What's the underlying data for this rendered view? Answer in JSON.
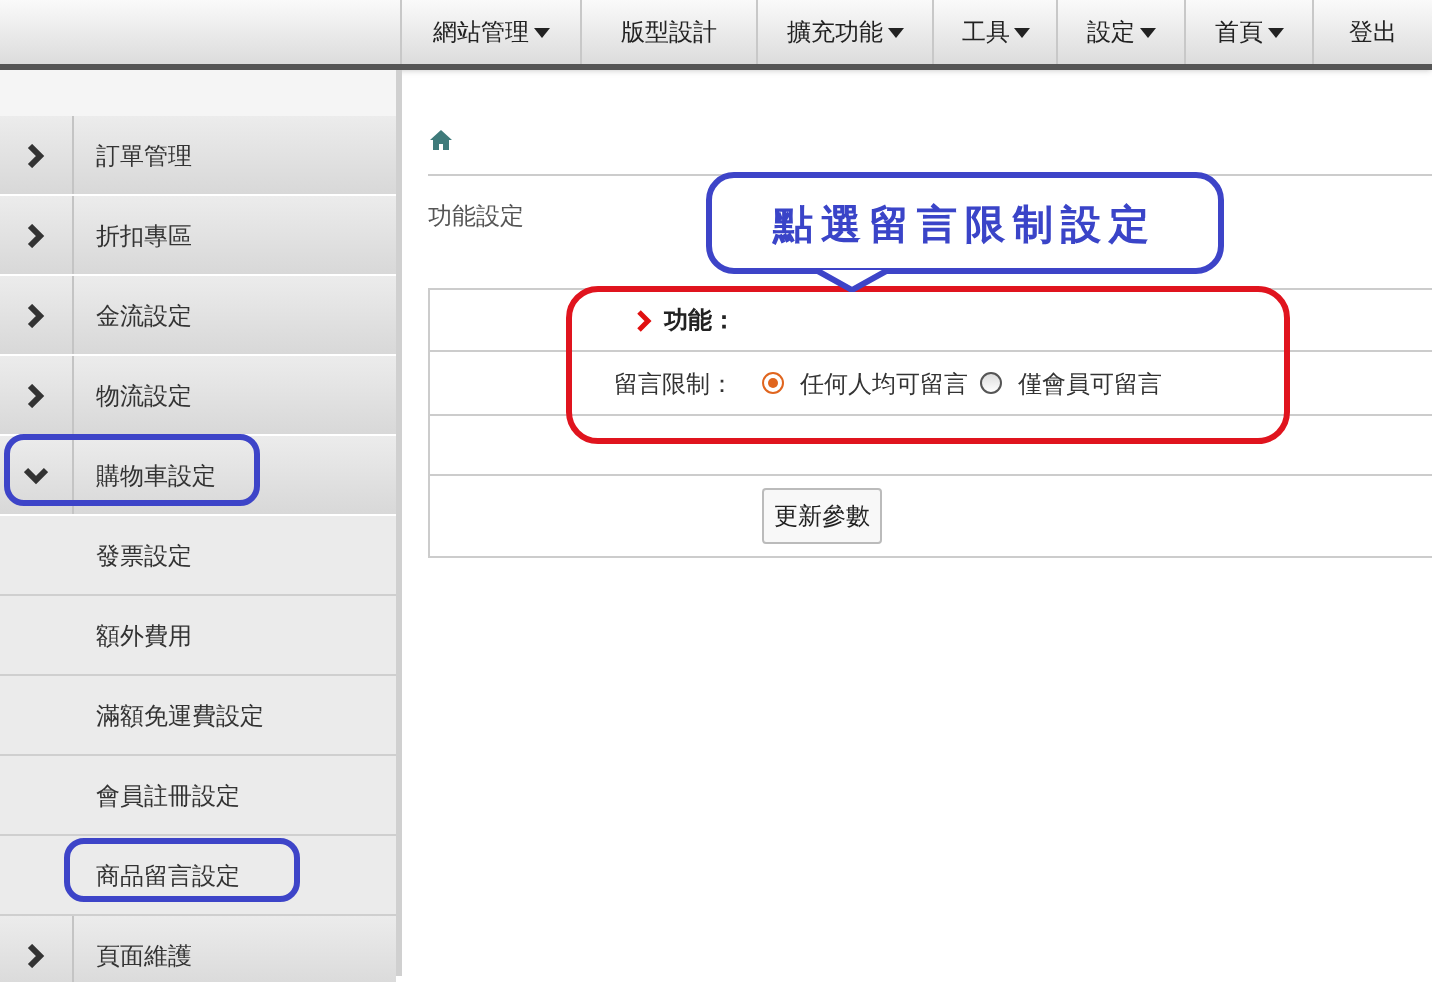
{
  "nav": [
    {
      "label": "網站管理",
      "dropdown": true
    },
    {
      "label": "版型設計",
      "dropdown": false
    },
    {
      "label": "擴充功能",
      "dropdown": true
    },
    {
      "label": "工具",
      "dropdown": true
    },
    {
      "label": "設定",
      "dropdown": true
    },
    {
      "label": "首頁",
      "dropdown": true
    },
    {
      "label": "登出",
      "dropdown": false
    }
  ],
  "sidebar": {
    "items": [
      {
        "kind": "group",
        "label": "訂單管理",
        "expanded": false,
        "highlighted": false
      },
      {
        "kind": "group",
        "label": "折扣專區",
        "expanded": false,
        "highlighted": false
      },
      {
        "kind": "group",
        "label": "金流設定",
        "expanded": false,
        "highlighted": false
      },
      {
        "kind": "group",
        "label": "物流設定",
        "expanded": false,
        "highlighted": false
      },
      {
        "kind": "group",
        "label": "購物車設定",
        "expanded": true,
        "highlighted": true
      },
      {
        "kind": "sub",
        "label": "發票設定",
        "highlighted": false
      },
      {
        "kind": "sub",
        "label": "額外費用",
        "highlighted": false
      },
      {
        "kind": "sub",
        "label": "滿額免運費設定",
        "highlighted": false
      },
      {
        "kind": "sub",
        "label": "會員註冊設定",
        "highlighted": false
      },
      {
        "kind": "sub",
        "label": "商品留言設定",
        "highlighted": true
      },
      {
        "kind": "group",
        "label": "頁面維護",
        "expanded": false,
        "highlighted": false
      }
    ]
  },
  "page_title": "功能設定",
  "callout": "點選留言限制設定",
  "form": {
    "section": "功能：",
    "field_label": "留言限制：",
    "options": [
      {
        "label": "任何人均可留言",
        "selected": true
      },
      {
        "label": "僅會員可留言",
        "selected": false
      }
    ],
    "submit": "更新參數"
  }
}
